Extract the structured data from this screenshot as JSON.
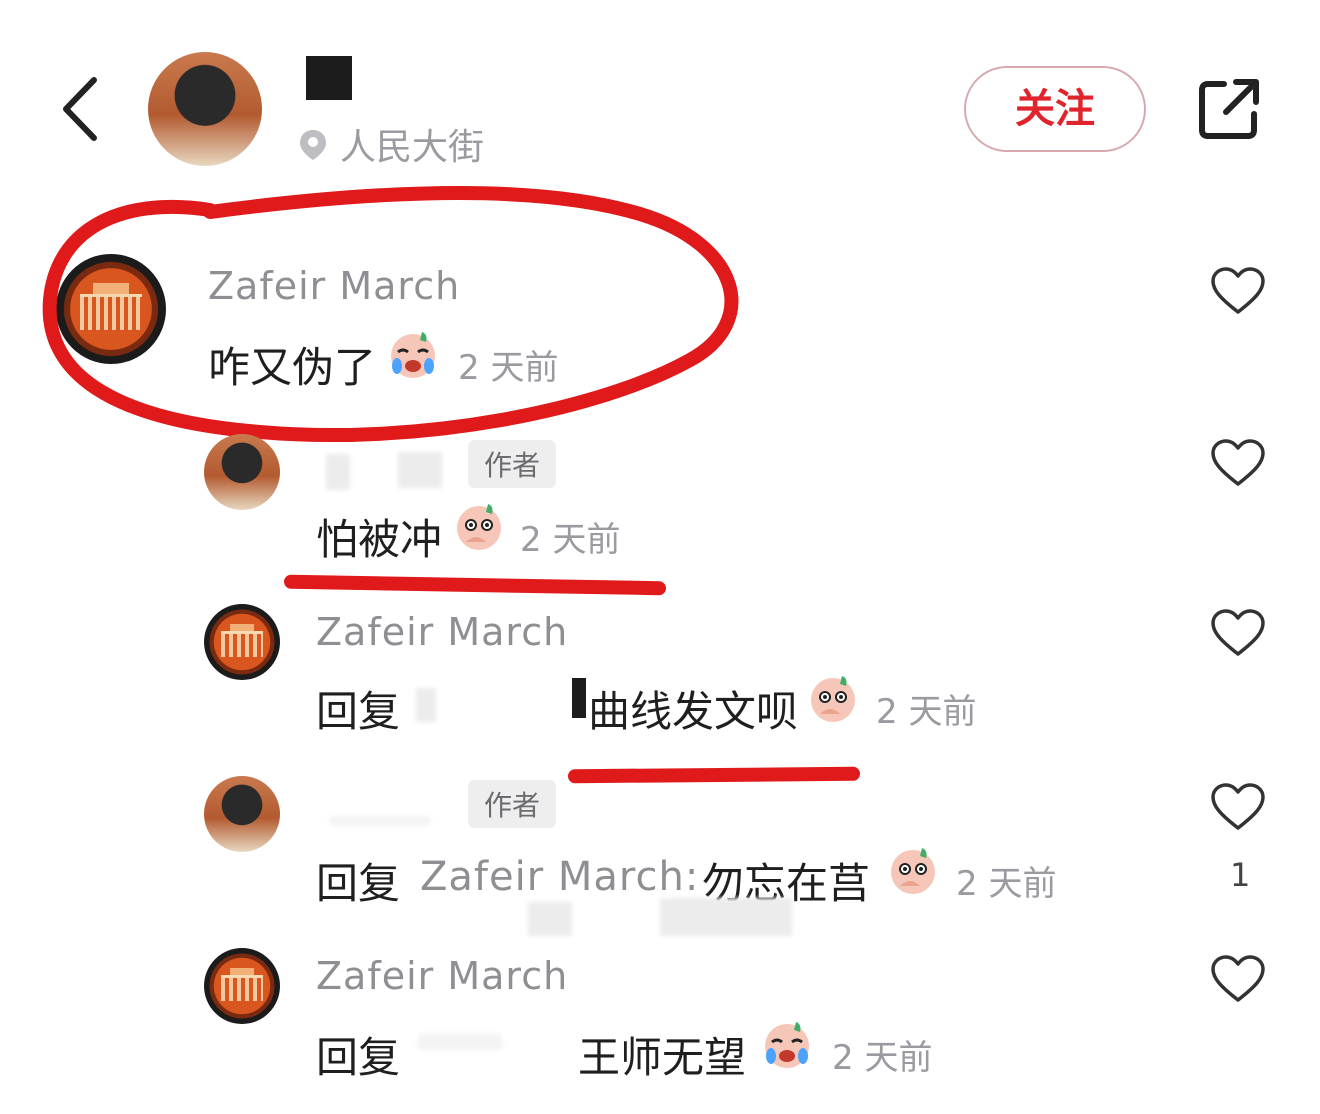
{
  "header": {
    "location": "人民大街",
    "follow_label": "关注"
  },
  "comments": [
    {
      "name": "Zafeir March",
      "text": "咋又伪了",
      "time": "2 天前"
    },
    {
      "tag": "作者",
      "text": "怕被冲",
      "time": "2 天前"
    },
    {
      "name": "Zafeir March",
      "prefix": "回复",
      "text": "曲线发文呗",
      "time": "2 天前"
    },
    {
      "tag": "作者",
      "prefix": "回复",
      "target": "Zafeir March:",
      "text": "勿忘在莒",
      "time": "2 天前",
      "likes": "1"
    },
    {
      "name": "Zafeir March",
      "prefix": "回复",
      "text": "王师无望",
      "time": "2 天前"
    }
  ],
  "icons": {
    "back": "chevron-left-icon",
    "share": "share-external-icon",
    "location": "location-pin-icon",
    "like": "heart-outline-icon"
  },
  "colors": {
    "accent": "#e0242c",
    "annotation": "#e01a1a",
    "meta": "#8e8e93"
  }
}
